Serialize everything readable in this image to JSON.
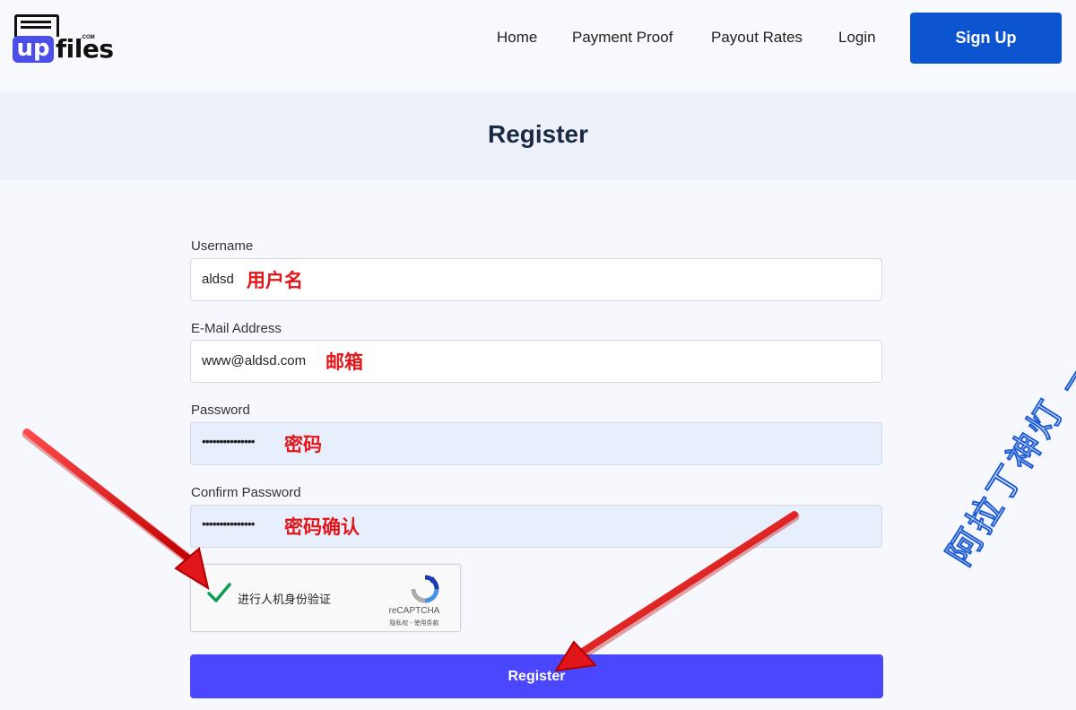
{
  "header": {
    "logo": {
      "up": "up",
      "files": "files",
      "com": ".COM"
    },
    "nav": [
      "Home",
      "Payment Proof",
      "Payout Rates",
      "Login"
    ],
    "signup_label": "Sign Up"
  },
  "page": {
    "title": "Register"
  },
  "form": {
    "username": {
      "label": "Username",
      "value": "aldsd",
      "annotation": "用户名"
    },
    "email": {
      "label": "E-Mail Address",
      "value": "www@aldsd.com",
      "annotation": "邮箱"
    },
    "password": {
      "label": "Password",
      "value": "•••••••••••••••",
      "annotation": "密码"
    },
    "confirm_password": {
      "label": "Confirm Password",
      "value": "•••••••••••••••",
      "annotation": "密码确认"
    },
    "captcha": {
      "label": "进行人机身份验证",
      "brand": "reCAPTCHA",
      "terms": "隐私权 - 使用条款",
      "checked": true
    },
    "submit_label": "Register"
  },
  "watermark": "阿拉丁神灯 — Aldsd.com",
  "colors": {
    "primary": "#0d55d0",
    "register": "#4a47ff",
    "annotation": "#e0161a",
    "arrow": "#e0161a",
    "watermark_stroke": "#1e5bd6"
  }
}
